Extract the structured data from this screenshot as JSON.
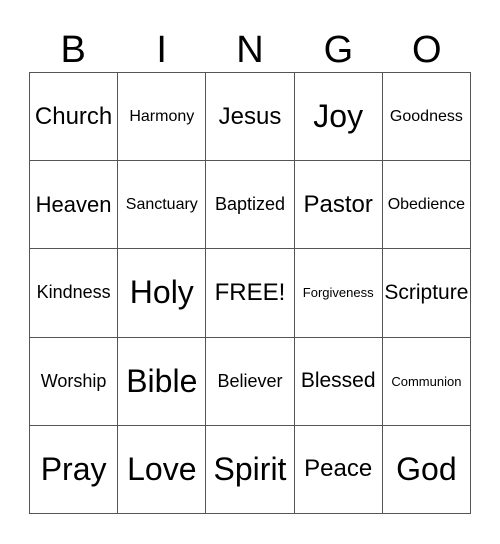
{
  "header": {
    "letters": [
      "B",
      "I",
      "N",
      "G",
      "O"
    ]
  },
  "grid": {
    "rows": [
      [
        "Church",
        "Harmony",
        "Jesus",
        "Joy",
        "Goodness"
      ],
      [
        "Heaven",
        "Sanctuary",
        "Baptized",
        "Pastor",
        "Obedience"
      ],
      [
        "Kindness",
        "Holy",
        "FREE!",
        "Forgiveness",
        "Scripture"
      ],
      [
        "Worship",
        "Bible",
        "Believer",
        "Blessed",
        "Communion"
      ],
      [
        "Pray",
        "Love",
        "Spirit",
        "Peace",
        "God"
      ]
    ]
  }
}
